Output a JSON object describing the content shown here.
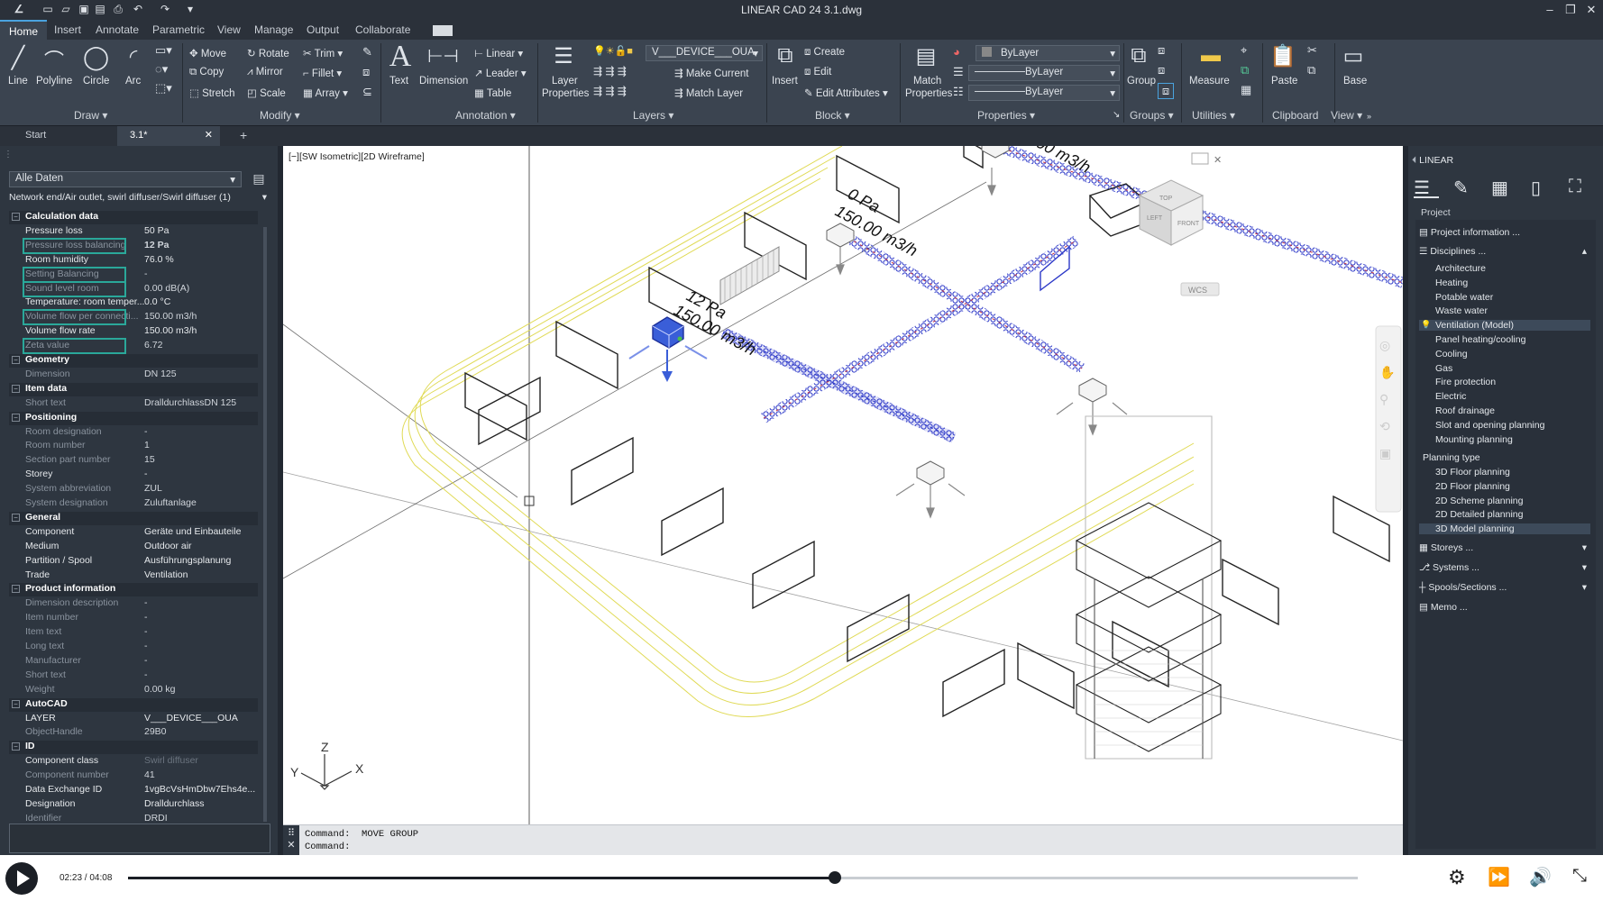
{
  "app": {
    "title": "LINEAR CAD 24   3.1.dwg"
  },
  "menu_tabs": [
    "Home",
    "Insert",
    "Annotate",
    "Parametric",
    "View",
    "Manage",
    "Output",
    "Collaborate"
  ],
  "ribbon": {
    "draw": {
      "line": "Line",
      "polyline": "Polyline",
      "circle": "Circle",
      "arc": "Arc",
      "panel": "Draw ▾"
    },
    "modify": {
      "move": "Move",
      "rotate": "Rotate",
      "trim": "Trim",
      "copy": "Copy",
      "mirror": "Mirror",
      "fillet": "Fillet",
      "stretch": "Stretch",
      "scale": "Scale",
      "array": "Array",
      "panel": "Modify ▾"
    },
    "annotation": {
      "text": "Text",
      "dimension": "Dimension",
      "linear": "Linear",
      "leader": "Leader",
      "table": "Table",
      "panel": "Annotation ▾"
    },
    "layers": {
      "layer_properties_1": "Layer",
      "layer_properties_2": "Properties",
      "layer_name": "V___DEVICE___OUA",
      "make_current": "Make Current",
      "match_layer": "Match Layer",
      "panel": "Layers ▾"
    },
    "block": {
      "insert": "Insert",
      "create": "Create",
      "edit": "Edit",
      "edit_attributes": "Edit Attributes",
      "panel": "Block ▾"
    },
    "properties": {
      "match_1": "Match",
      "match_2": "Properties",
      "color": "ByLayer",
      "linetype": "ByLayer",
      "lineweight": "ByLayer",
      "panel": "Properties ▾"
    },
    "groups": {
      "group": "Group",
      "panel": "Groups ▾"
    },
    "utilities": {
      "measure": "Measure",
      "panel": "Utilities ▾"
    },
    "clipboard": {
      "paste": "Paste",
      "panel": "Clipboard"
    },
    "view": {
      "base": "Base",
      "panel": "View ▾"
    }
  },
  "doc_tabs": {
    "start": "Start",
    "active": "3.1*",
    "add": "+"
  },
  "left_panel": {
    "filter": "Alle Daten",
    "selection": "Network end/Air outlet, swirl diffuser/Swirl diffuser (1)",
    "rows": [
      {
        "k": "Calculation data",
        "v": "",
        "t": "hdr"
      },
      {
        "k": "Pressure loss",
        "v": "50 Pa",
        "t": "n"
      },
      {
        "k": "Pressure loss balancing",
        "v": "12 Pa",
        "t": "d"
      },
      {
        "k": "Room humidity",
        "v": "76.0 %",
        "t": "n"
      },
      {
        "k": "Setting Balancing",
        "v": "-",
        "t": "d"
      },
      {
        "k": "Sound level room",
        "v": "0.00 dB(A)",
        "t": "d"
      },
      {
        "k": "Temperature: room temper...",
        "v": "0.0 °C",
        "t": "n"
      },
      {
        "k": "Volume flow per connecti...",
        "v": "150.00 m3/h",
        "t": "d"
      },
      {
        "k": "Volume flow rate",
        "v": "150.00 m3/h",
        "t": "n"
      },
      {
        "k": "Zeta value",
        "v": "6.72",
        "t": "d"
      },
      {
        "k": "Geometry",
        "v": "",
        "t": "hdr"
      },
      {
        "k": "Dimension",
        "v": "DN 125",
        "t": "d"
      },
      {
        "k": "Item data",
        "v": "",
        "t": "hdr"
      },
      {
        "k": "Short text",
        "v": "DralldurchlassDN 125",
        "t": "d"
      },
      {
        "k": "Positioning",
        "v": "",
        "t": "hdr"
      },
      {
        "k": "Room designation",
        "v": "-",
        "t": "d"
      },
      {
        "k": "Room number",
        "v": "1",
        "t": "d"
      },
      {
        "k": "Section part number",
        "v": "15",
        "t": "d"
      },
      {
        "k": "Storey",
        "v": "-",
        "t": "n"
      },
      {
        "k": "System abbreviation",
        "v": "ZUL",
        "t": "d"
      },
      {
        "k": "System designation",
        "v": "Zuluftanlage",
        "t": "d"
      },
      {
        "k": "General",
        "v": "",
        "t": "hdr"
      },
      {
        "k": "Component",
        "v": "Geräte und Einbauteile",
        "t": "n"
      },
      {
        "k": "Medium",
        "v": "Outdoor air",
        "t": "n"
      },
      {
        "k": "Partition / Spool",
        "v": "Ausführungsplanung",
        "t": "n"
      },
      {
        "k": "Trade",
        "v": "Ventilation",
        "t": "n"
      },
      {
        "k": "Product information",
        "v": "",
        "t": "hdr"
      },
      {
        "k": "Dimension description",
        "v": "-",
        "t": "d"
      },
      {
        "k": "Item number",
        "v": "-",
        "t": "d"
      },
      {
        "k": "Item text",
        "v": "-",
        "t": "d"
      },
      {
        "k": "Long text",
        "v": "-",
        "t": "d"
      },
      {
        "k": "Manufacturer",
        "v": "-",
        "t": "d"
      },
      {
        "k": "Short text",
        "v": "-",
        "t": "d"
      },
      {
        "k": "Weight",
        "v": "0.00 kg",
        "t": "d"
      },
      {
        "k": "AutoCAD",
        "v": "",
        "t": "hdr"
      },
      {
        "k": "LAYER",
        "v": "V___DEVICE___OUA",
        "t": "n"
      },
      {
        "k": "ObjectHandle",
        "v": "29B0",
        "t": "d"
      },
      {
        "k": "ID",
        "v": "",
        "t": "hdr"
      },
      {
        "k": "Component class",
        "v": "Swirl diffuser",
        "t": "n"
      },
      {
        "k": "Component number",
        "v": "41",
        "t": "d"
      },
      {
        "k": "Data Exchange ID",
        "v": "1vgBcVsHmDbw7Ehs4e...",
        "t": "n"
      },
      {
        "k": "Designation",
        "v": "Dralldurchlass",
        "t": "n"
      },
      {
        "k": "Identifier",
        "v": "DRDI",
        "t": "d"
      }
    ]
  },
  "viewport": {
    "label": "[−][SW Isometric][2D Wireframe]",
    "annotations": {
      "a1": "12 Pa",
      "a2": "150.00  m3/h",
      "a3": "0 Pa",
      "a4": "150.00  m3/h",
      "a5": "00  m3/h"
    },
    "wcs": "WCS",
    "viewcube": {
      "top": "TOP",
      "front": "FRONT",
      "left": "LEFT"
    },
    "axes": {
      "x": "X",
      "y": "Y",
      "z": "Z"
    }
  },
  "command": {
    "line1_label": "Command:",
    "line1_value": "MOVE  GROUP",
    "line2_label": "Command:"
  },
  "right_panel": {
    "title": "LINEAR",
    "section": "Project",
    "project_information": "Project information ...",
    "disciplines": "Disciplines ...",
    "discipline_items": [
      "Architecture",
      "Heating",
      "Potable water",
      "Waste water",
      "Ventilation (Model)",
      "Panel heating/cooling",
      "Cooling",
      "Gas",
      "Fire protection",
      "Electric",
      "Roof drainage",
      "Slot and opening planning",
      "Mounting planning"
    ],
    "planning_type": "Planning type",
    "planning_items": [
      "3D Floor planning",
      "2D Floor planning",
      "2D Scheme planning",
      "2D Detailed planning",
      "3D Model planning"
    ],
    "storeys": "Storeys ...",
    "systems": "Systems ...",
    "spools": "Spools/Sections ...",
    "memo": "Memo ..."
  },
  "player": {
    "time": "02:23 / 04:08",
    "progress": 0.575
  }
}
